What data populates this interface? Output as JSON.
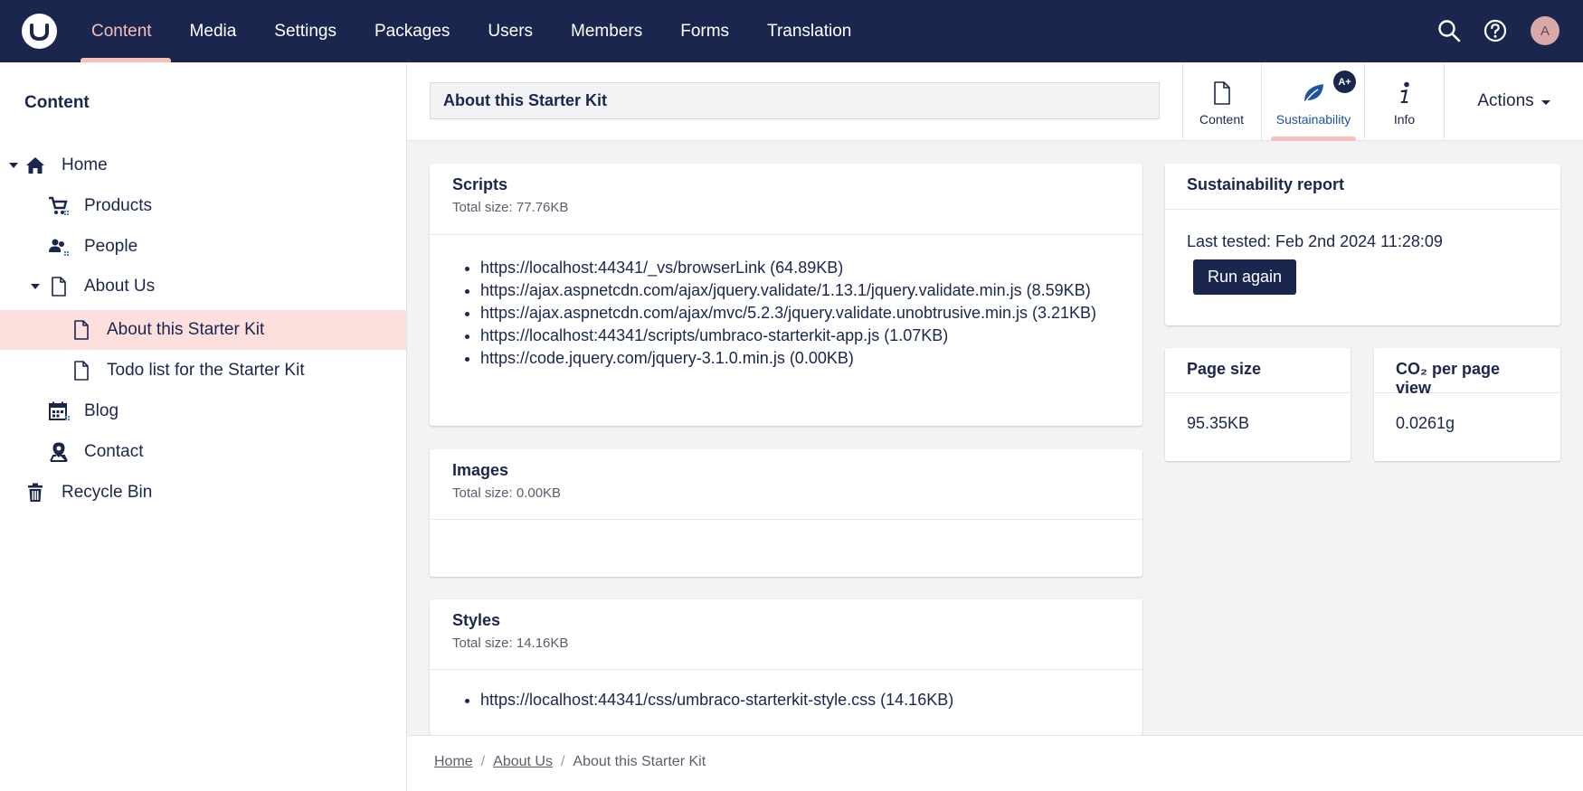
{
  "topbar": {
    "nav": [
      "Content",
      "Media",
      "Settings",
      "Packages",
      "Users",
      "Members",
      "Forms",
      "Translation"
    ],
    "active_index": 0,
    "avatar_initial": "A"
  },
  "sidebar": {
    "title": "Content",
    "items": [
      {
        "label": "Home",
        "icon": "home-icon"
      },
      {
        "label": "Products",
        "icon": "cart-icon"
      },
      {
        "label": "People",
        "icon": "people-icon"
      },
      {
        "label": "About Us",
        "icon": "document-icon"
      },
      {
        "label": "About this Starter Kit",
        "icon": "document-icon"
      },
      {
        "label": "Todo list for the Starter Kit",
        "icon": "document-icon"
      },
      {
        "label": "Blog",
        "icon": "calendar-icon"
      },
      {
        "label": "Contact",
        "icon": "map-pin-icon"
      },
      {
        "label": "Recycle Bin",
        "icon": "trash-icon"
      }
    ]
  },
  "header": {
    "page_name": "About this Starter Kit",
    "tabs": [
      "Content",
      "Sustainability",
      "Info"
    ],
    "active_tab": "Sustainability",
    "badge": "A+",
    "actions_label": "Actions"
  },
  "scripts": {
    "title": "Scripts",
    "total": "Total size: 77.76KB",
    "items": [
      "https://localhost:44341/_vs/browserLink (64.89KB)",
      "https://ajax.aspnetcdn.com/ajax/jquery.validate/1.13.1/jquery.validate.min.js (8.59KB)",
      "https://ajax.aspnetcdn.com/ajax/mvc/5.2.3/jquery.validate.unobtrusive.min.js (3.21KB)",
      "https://localhost:44341/scripts/umbraco-starterkit-app.js (1.07KB)",
      "https://code.jquery.com/jquery-3.1.0.min.js (0.00KB)"
    ]
  },
  "images": {
    "title": "Images",
    "total": "Total size: 0.00KB"
  },
  "styles": {
    "title": "Styles",
    "total": "Total size: 14.16KB",
    "items": [
      "https://localhost:44341/css/umbraco-starterkit-style.css (14.16KB)"
    ]
  },
  "report": {
    "title": "Sustainability report",
    "last_tested": "Last tested: Feb 2nd 2024 11:28:09",
    "run_again": "Run again"
  },
  "page_size": {
    "title": "Page size",
    "value": "95.35KB"
  },
  "co2": {
    "title": "CO₂ per page view",
    "value": "0.0261g"
  },
  "breadcrumb": {
    "home": "Home",
    "about": "About Us",
    "current": "About this Starter Kit",
    "separator": "/"
  },
  "colors": {
    "primary": "#1b264f",
    "accent": "#f5c1bc",
    "selected_bg": "#fde0de",
    "active_tab_text": "#2152a3"
  }
}
